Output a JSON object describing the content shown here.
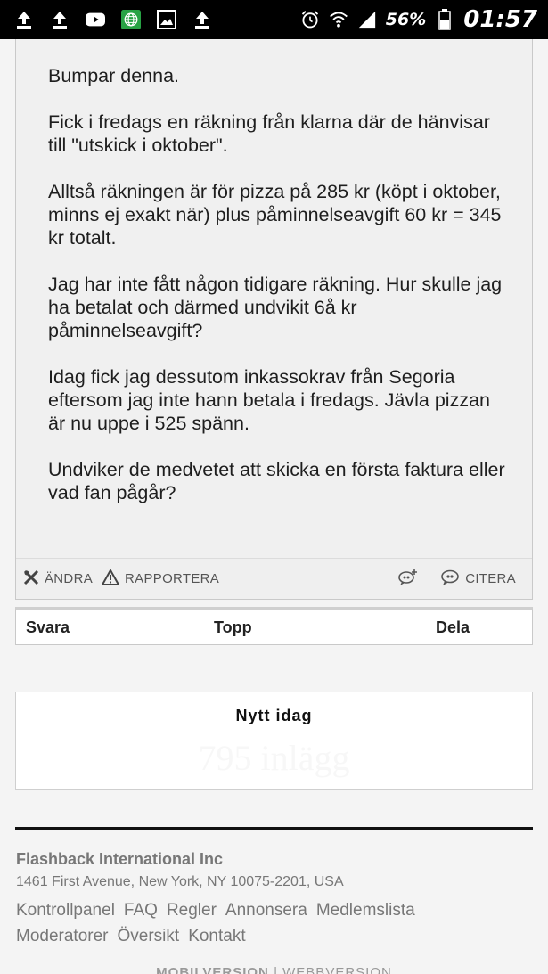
{
  "status_bar": {
    "icons_left": [
      "upload-icon",
      "upload-icon",
      "youtube-icon",
      "browser-icon",
      "gallery-icon",
      "upload-icon"
    ],
    "battery_percent": "56%",
    "time": "01:57"
  },
  "post": {
    "paragraphs": [
      "Bumpar denna.",
      "Fick i fredags en räkning från klarna där de hänvisar till \"utskick i oktober\".",
      "Alltså räkningen är för pizza på 285 kr (köpt i oktober, minns ej exakt när) plus påminnelseavgift 60 kr = 345 kr totalt.",
      "Jag har inte fått någon tidigare räkning. Hur skulle jag ha betalat och därmed undvikit 6å kr påminnelseavgift?",
      "Idag fick jag dessutom inkassokrav från Segoria eftersom jag inte hann betala i fredags. Jävla pizzan är nu uppe i 525 spänn.",
      "Undviker de medvetet att skicka en första faktura eller vad fan pågår?"
    ],
    "actions": {
      "edit": "ÄNDRA",
      "report": "RAPPORTERA",
      "quote": "CITERA"
    }
  },
  "reply_bar": {
    "reply": "Svara",
    "top": "Topp",
    "share": "Dela"
  },
  "new_today": {
    "title": "Nytt idag",
    "count": "795 inlägg"
  },
  "footer": {
    "company": "Flashback International Inc",
    "address": "1461 First Avenue, New York, NY 10075-2201, USA",
    "links": [
      "Kontrollpanel",
      "FAQ",
      "Regler",
      "Annonsera",
      "Medlemslista",
      "Moderatorer",
      "Översikt",
      "Kontakt"
    ],
    "mobile_version": "MOBILVERSION",
    "web_version": "WEBBVERSION"
  }
}
